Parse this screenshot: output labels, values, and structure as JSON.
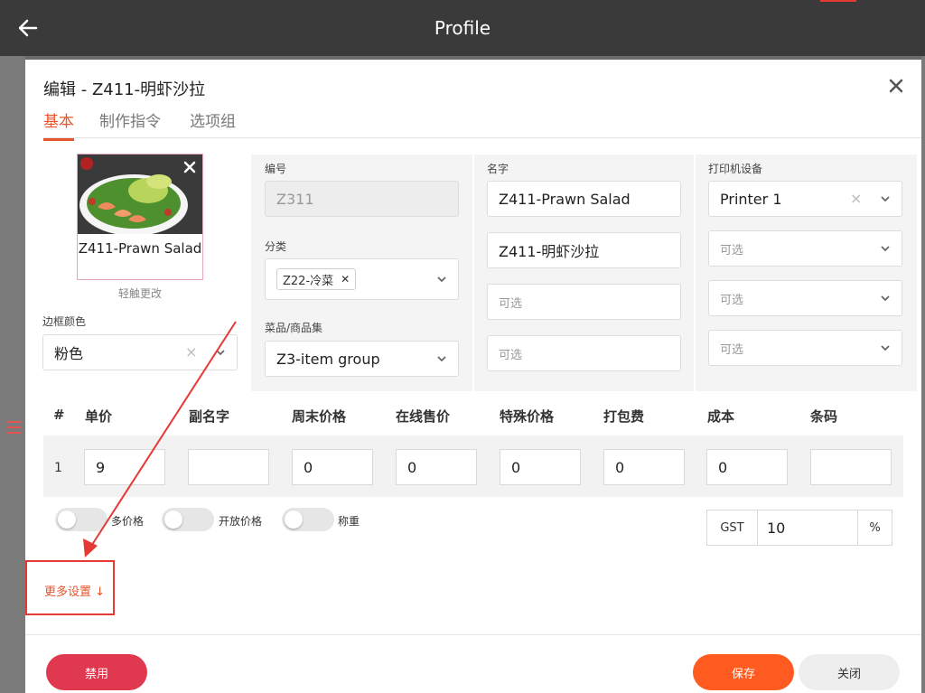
{
  "header": {
    "title": "Profile"
  },
  "modal": {
    "title": "编辑 - Z411-明虾沙拉",
    "tabs": [
      {
        "label": "基本"
      },
      {
        "label": "制作指令"
      },
      {
        "label": "选项组"
      }
    ]
  },
  "photo": {
    "name": "Z411-Prawn Salad",
    "hint": "轻触更改"
  },
  "border_color": {
    "label": "边框颜色",
    "value": "粉色"
  },
  "code": {
    "label": "编号",
    "value": "Z311"
  },
  "category": {
    "label": "分类",
    "tag": "Z22-冷菜"
  },
  "item_group": {
    "label": "菜品/商品集",
    "value": "Z3-item group"
  },
  "names": {
    "label": "名字",
    "values": [
      "Z411-Prawn Salad",
      "Z411-明虾沙拉"
    ],
    "placeholders": [
      "可选",
      "可选"
    ]
  },
  "printers": {
    "label": "打印机设备",
    "selected": "Printer 1",
    "placeholders": [
      "可选",
      "可选",
      "可选"
    ]
  },
  "price_table": {
    "headers": [
      "#",
      "单价",
      "副名字",
      "周末价格",
      "在线售价",
      "特殊价格",
      "打包费",
      "成本",
      "条码"
    ],
    "row": {
      "index": "1",
      "values": [
        "9",
        "",
        "0",
        "0",
        "0",
        "0",
        "0",
        ""
      ]
    }
  },
  "toggles": [
    {
      "label": "多价格",
      "on": false
    },
    {
      "label": "开放价格",
      "on": false
    },
    {
      "label": "称重",
      "on": false
    }
  ],
  "gst": {
    "label": "GST",
    "value": "10",
    "unit": "%"
  },
  "more_settings": "更多设置 ↓",
  "buttons": {
    "disable": "禁用",
    "save": "保存",
    "close": "关闭"
  },
  "colors": {
    "accent": "#e8542c",
    "save": "#ff5a1f",
    "disable": "#e0384f",
    "annotation": "#e53935"
  }
}
